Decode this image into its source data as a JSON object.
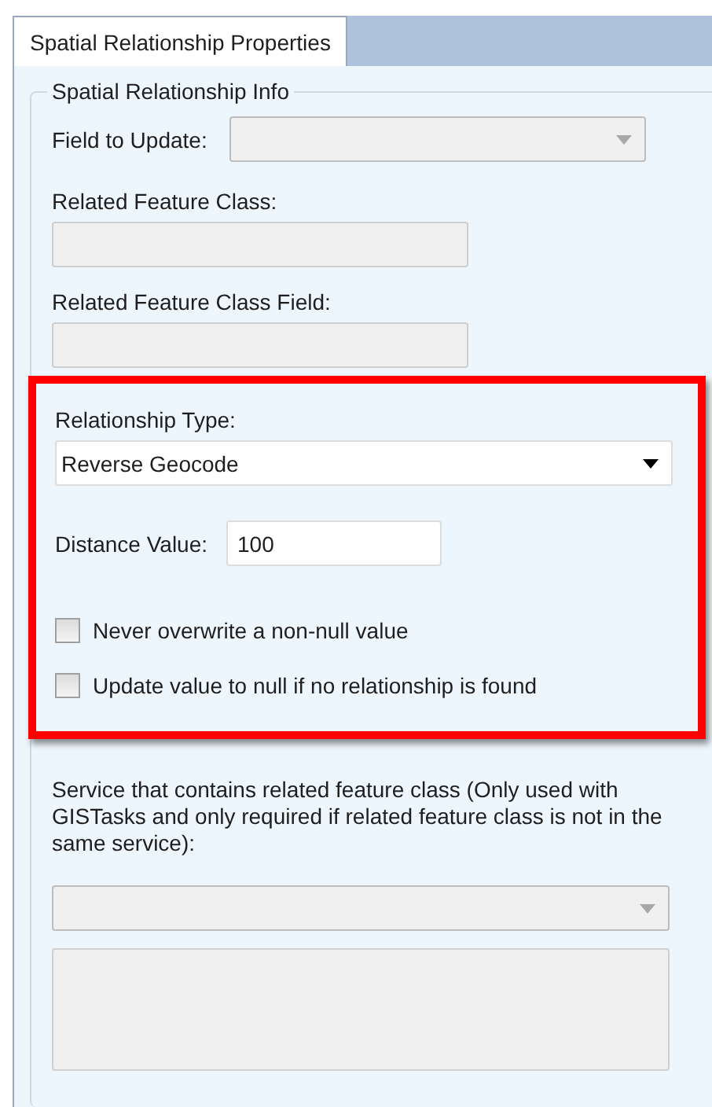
{
  "tab": {
    "label": "Spatial Relationship Properties",
    "selected": true
  },
  "group": {
    "title": "Spatial Relationship Info"
  },
  "field_to_update": {
    "label": "Field to Update:",
    "disabled": true
  },
  "related_feature_class": {
    "label": "Related Feature Class:",
    "disabled": true
  },
  "related_feature_class_field": {
    "label": "Related Feature Class Field:",
    "disabled": true
  },
  "relationship_section": {
    "highlighted": true,
    "relationship_type": {
      "label": "Relationship Type:",
      "value": "Reverse Geocode",
      "disabled": false
    },
    "distance": {
      "label": "Distance Value:",
      "value": "100"
    },
    "options": [
      {
        "label": "Never overwrite a non-null value",
        "checked": false
      },
      {
        "label": "Update value to null if no relationship is found",
        "checked": false
      }
    ]
  },
  "service": {
    "label": "Service that contains related feature class (Only used with GISTasks and only required if related feature class is not in the same service):",
    "dropdown_disabled": true,
    "list_disabled": true
  }
}
